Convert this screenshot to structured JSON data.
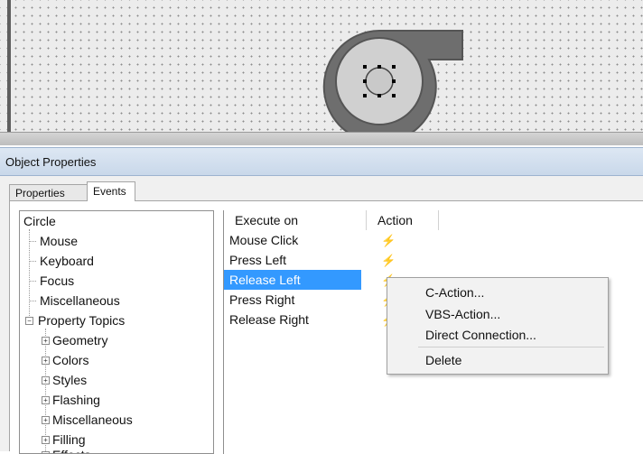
{
  "window": {
    "title": "Object Properties"
  },
  "tabs": [
    {
      "label": "Properties",
      "active": false
    },
    {
      "label": "Events",
      "active": true
    }
  ],
  "tree": {
    "root": "Circle",
    "items": [
      {
        "label": "Mouse",
        "selected": false
      },
      {
        "label": "Keyboard"
      },
      {
        "label": "Focus"
      },
      {
        "label": "Miscellaneous"
      }
    ],
    "property_topics": {
      "label": "Property Topics",
      "children": [
        "Geometry",
        "Colors",
        "Styles",
        "Flashing",
        "Miscellaneous",
        "Filling",
        "Effects"
      ]
    }
  },
  "events_table": {
    "headers": {
      "execute_on": "Execute on",
      "action": "Action"
    },
    "rows": [
      {
        "label": "Mouse Click",
        "icon": "lightning-icon"
      },
      {
        "label": "Press Left",
        "icon": "lightning-icon"
      },
      {
        "label": "Release Left",
        "icon": "lightning-icon",
        "selected": true
      },
      {
        "label": "Press Right",
        "icon": "lightning-icon"
      },
      {
        "label": "Release Right",
        "icon": "lightning-icon"
      }
    ]
  },
  "context_menu": {
    "items": [
      "C-Action...",
      "VBS-Action...",
      "Direct Connection...",
      "Delete"
    ]
  },
  "colors": {
    "selection": "#3399ff",
    "object_fill": "#c9c9c9",
    "object_stroke": "#5a5a5a"
  }
}
